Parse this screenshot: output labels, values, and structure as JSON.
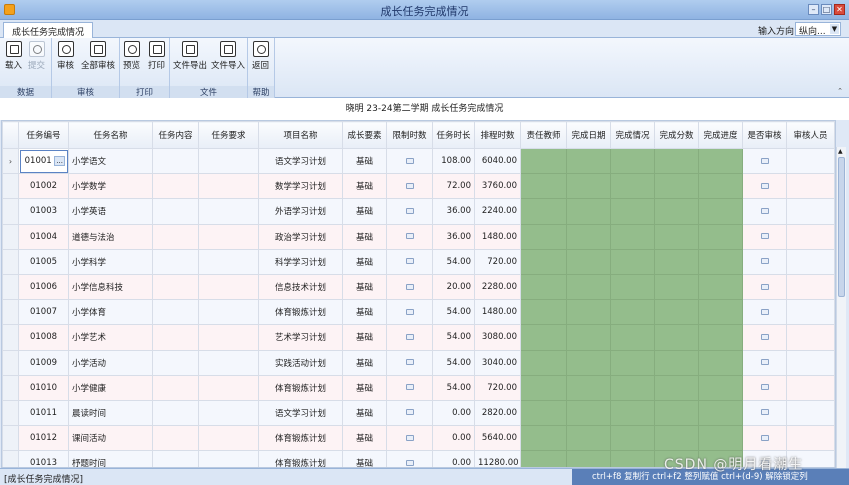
{
  "window": {
    "title": "成长任务完成情况",
    "btn_min": "–",
    "btn_max": "□",
    "btn_close": "✕"
  },
  "tab": {
    "label": "成长任务完成情况"
  },
  "direction": {
    "label": "输入方向",
    "value": "纵向..."
  },
  "ribbon": {
    "groups": [
      {
        "label": "数据",
        "buttons": [
          "载入",
          "提交"
        ]
      },
      {
        "label": "审核",
        "buttons": [
          "审核",
          "全部审核"
        ]
      },
      {
        "label": "打印",
        "buttons": [
          "预览",
          "打印"
        ]
      },
      {
        "label": "文件",
        "buttons": [
          "文件导出",
          "文件导入"
        ]
      },
      {
        "label": "帮助",
        "buttons": [
          "返回"
        ]
      }
    ],
    "collapse": "⌃"
  },
  "caption": "晓明 23-24第二学期 成长任务完成情况",
  "grid": {
    "columns": [
      "任务编号",
      "任务名称",
      "任务内容",
      "任务要求",
      "项目名称",
      "成长要素",
      "限制时数",
      "任务时长",
      "排程时数",
      "责任教师",
      "完成日期",
      "完成情况",
      "完成分数",
      "完成进度",
      "是否审核",
      "审核人员"
    ],
    "rows": [
      {
        "id": "01001",
        "name": "小学语文",
        "project": "语文学习计划",
        "element": "基础",
        "hours": "108.00",
        "sched": "6040.00"
      },
      {
        "id": "01002",
        "name": "小学数学",
        "project": "数学学习计划",
        "element": "基础",
        "hours": "72.00",
        "sched": "3760.00"
      },
      {
        "id": "01003",
        "name": "小学英语",
        "project": "外语学习计划",
        "element": "基础",
        "hours": "36.00",
        "sched": "2240.00"
      },
      {
        "id": "01004",
        "name": "道德与法治",
        "project": "政治学习计划",
        "element": "基础",
        "hours": "36.00",
        "sched": "1480.00"
      },
      {
        "id": "01005",
        "name": "小学科学",
        "project": "科学学习计划",
        "element": "基础",
        "hours": "54.00",
        "sched": "720.00"
      },
      {
        "id": "01006",
        "name": "小学信息科技",
        "project": "信息技术计划",
        "element": "基础",
        "hours": "20.00",
        "sched": "2280.00"
      },
      {
        "id": "01007",
        "name": "小学体育",
        "project": "体育锻炼计划",
        "element": "基础",
        "hours": "54.00",
        "sched": "1480.00"
      },
      {
        "id": "01008",
        "name": "小学艺术",
        "project": "艺术学习计划",
        "element": "基础",
        "hours": "54.00",
        "sched": "3080.00"
      },
      {
        "id": "01009",
        "name": "小学活动",
        "project": "实践活动计划",
        "element": "基础",
        "hours": "54.00",
        "sched": "3040.00"
      },
      {
        "id": "01010",
        "name": "小学健康",
        "project": "体育锻炼计划",
        "element": "基础",
        "hours": "54.00",
        "sched": "720.00"
      },
      {
        "id": "01011",
        "name": "晨读时间",
        "project": "语文学习计划",
        "element": "基础",
        "hours": "0.00",
        "sched": "2820.00"
      },
      {
        "id": "01012",
        "name": "课间活动",
        "project": "体育锻炼计划",
        "element": "基础",
        "hours": "0.00",
        "sched": "5640.00"
      },
      {
        "id": "01013",
        "name": "杼题时间",
        "project": "体育锻炼计划",
        "element": "基础",
        "hours": "0.00",
        "sched": "11280.00"
      }
    ],
    "row_indicator": "›",
    "active_cell_suffix": "..."
  },
  "status": {
    "left": "[成长任务完成情况]",
    "right": "ctrl+f8 复制行 ctrl+f2 整列赋值 ctrl+(d-9) 解除锁定列"
  },
  "watermark": "CSDN @明月看潮生",
  "colors": {
    "green_cell": "#94bd8c",
    "status_blue": "#5a7fb8"
  }
}
